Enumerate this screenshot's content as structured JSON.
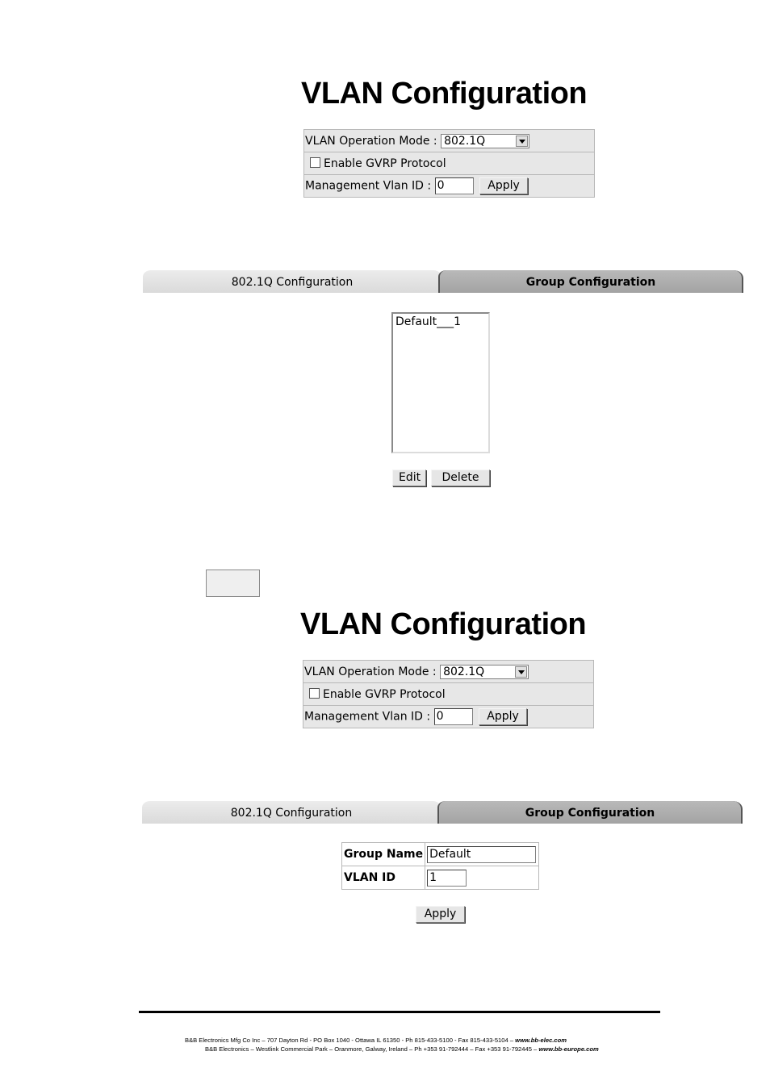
{
  "title": "VLAN Configuration",
  "settings": {
    "mode_label": "VLAN Operation Mode :",
    "mode_value": "802.1Q",
    "gvrp_label": "Enable GVRP Protocol",
    "mgmt_label": "Management Vlan ID :",
    "mgmt_value": "0",
    "apply_label": "Apply"
  },
  "tabs": {
    "dot1q": "802.1Q Configuration",
    "group": "Group Configuration"
  },
  "group_list": {
    "items": [
      "Default___1"
    ],
    "edit_label": "Edit",
    "delete_label": "Delete"
  },
  "group_form": {
    "name_label": "Group Name",
    "name_value": "Default",
    "vid_label": "VLAN ID",
    "vid_value": "1",
    "apply_label": "Apply"
  },
  "footer": {
    "line1_text": "B&B Electronics Mfg Co Inc – 707 Dayton Rd - PO Box 1040 - Ottawa IL 61350 - Ph 815-433-5100 - Fax 815-433-5104 – ",
    "line1_url": "www.bb-elec.com",
    "line2_text": "B&B Electronics – Westlink Commercial Park – Oranmore, Galway, Ireland – Ph +353 91-792444 – Fax +353 91-792445 – ",
    "line2_url": "www.bb-europe.com"
  }
}
